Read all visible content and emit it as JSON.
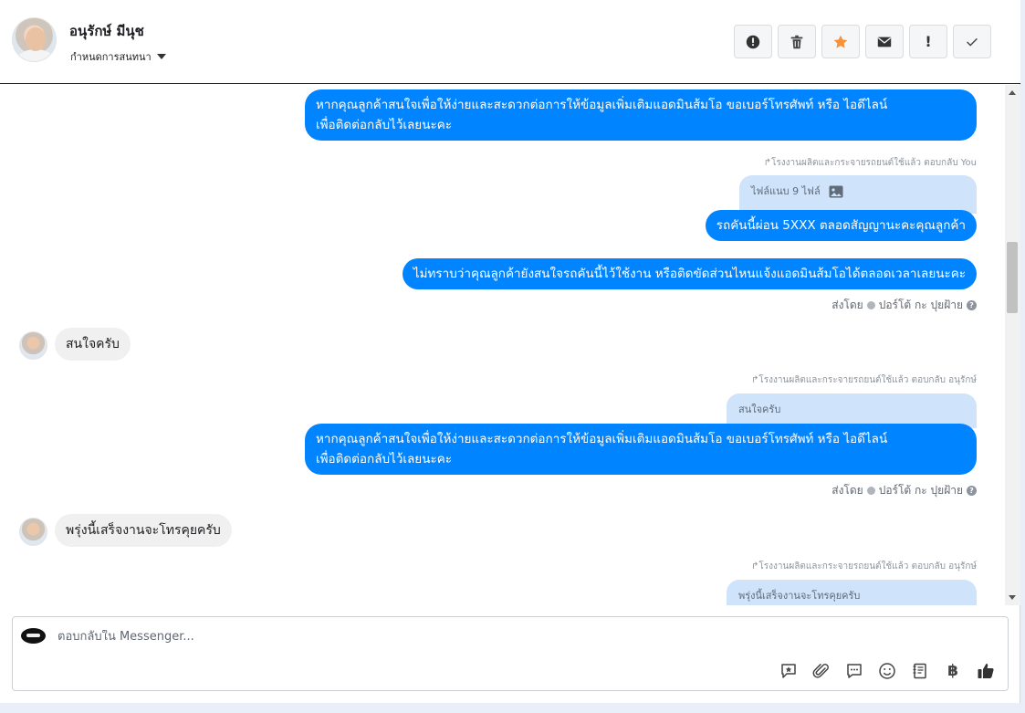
{
  "header": {
    "contact_name": "อนุรักษ์ มีนุช",
    "assign_label": "กำหนดการสนทนา"
  },
  "toolbar": [
    {
      "icon": "alert-circle-icon"
    },
    {
      "icon": "trash-icon"
    },
    {
      "icon": "star-icon",
      "color": "#f7923a"
    },
    {
      "icon": "mail-icon"
    },
    {
      "icon": "exclamation-icon",
      "label": "!"
    },
    {
      "icon": "check-icon"
    }
  ],
  "messages": {
    "m1": "หากคุณลูกค้าสนใจเพื่อให้ง่ายและสะดวกต่อการให้ข้อมูลเพิ่มเติมแอดมินส้มโอ ขอเบอร์โทรศัพท์ หรือ ไอดีไลน์\nเพื่อติดต่อกลับไว้เลยนะคะ",
    "meta1": "โรงงานผลิตและกระจายรถยนต์ใช้แล้ว ตอบกลับ You",
    "quote1": "ไฟล์แนบ 9 ไฟล์",
    "m2": "รถคันนี้ผ่อน 5XXX ตลอดสัญญานะคะคุณลูกค้า",
    "m3": "ไม่ทราบว่าคุณลูกค้ายังสนใจรถคันนี้ไว้ใช้งาน หรือติดขัดส่วนไหนแจ้งแอดมินส้มโอได้ตลอดเวลาเลยนะคะ",
    "sent_by_label": "ส่งโดย",
    "sent_by_name": "ปอร์โต้ กะ ปุยฝ้าย",
    "in1": "สนใจครับ",
    "meta2": "โรงงานผลิตและกระจายรถยนต์ใช้แล้ว ตอบกลับ อนุรักษ์",
    "quote2": "สนใจครับ",
    "m4": "หากคุณลูกค้าสนใจเพื่อให้ง่ายและสะดวกต่อการให้ข้อมูลเพิ่มเติมแอดมินส้มโอ ขอเบอร์โทรศัพท์ หรือ ไอดีไลน์\nเพื่อติดต่อกลับไว้เลยนะคะ",
    "in2": "พรุ่งนี้เสร็จงานจะโทรคุยครับ",
    "meta3": "โรงงานผลิตและกระจายรถยนต์ใช้แล้ว ตอบกลับ อนุรักษ์",
    "quote3": "พรุ่งนี้เสร็จงานจะโทรคุยครับ"
  },
  "composer": {
    "placeholder": "ตอบกลับใน Messenger...",
    "currency_symbol": "฿"
  },
  "colors": {
    "bubble_out": "#0084ff",
    "bubble_in": "#f0f0f0",
    "quote": "#cfe3fb",
    "star": "#f7923a"
  }
}
